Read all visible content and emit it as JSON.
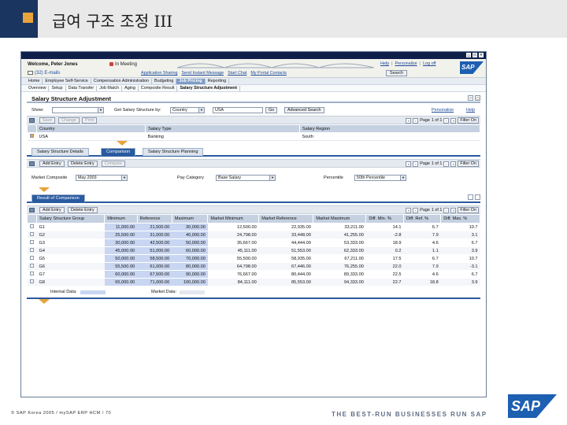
{
  "slide": {
    "title": "급여 구조 조정 III",
    "copyright": "© SAP Korea 2005 / mySAP ERP HCM / 70",
    "slogan": "THE BEST-RUN BUSINESSES RUN SAP",
    "logo": "SAP"
  },
  "portal": {
    "welcome": "Welcome, Peter Jones",
    "status": "In Meeting",
    "emails": "(32) E-mails",
    "top_links": [
      "Help",
      "Personalize",
      "Log off"
    ],
    "links": [
      "Application Sharing",
      "Send Instant Message",
      "Start Chat",
      "My Portal Contacts"
    ],
    "search_button": "Search",
    "nav_top": [
      "Home",
      "Employee Self-Service",
      "Compensation Administration",
      "Budgeting",
      "Job Pricing",
      "Reporting"
    ],
    "nav_top_active": 4,
    "nav_sub": [
      "Overview",
      "Setup",
      "Data Transfer",
      "Job Match",
      "Aging",
      "Composite Result",
      "Salary Structure Adjustment"
    ]
  },
  "page": {
    "title": "Salary Structure Adjustment",
    "show_label": "Show:",
    "get_label": "Get Salary Structure by:",
    "get_value": "Country",
    "country_value": "USA",
    "go": "Go",
    "advanced": "Advanced Search",
    "personalize": "Personalize",
    "help": "Help",
    "toolbar_buttons": [
      "Save",
      "Change",
      "Print"
    ],
    "page_text": "Page",
    "page_of": "1 of 1",
    "filter": "Filter On",
    "columns": [
      "Country",
      "Salary Type",
      "Salary Region"
    ],
    "row": [
      "USA",
      "Banking",
      "South"
    ]
  },
  "tabs": [
    "Salary Structure Details",
    "Comparison",
    "Salary Structure Planning"
  ],
  "comparison": {
    "add_entry": "Add Entry",
    "delete_entry": "Delete Entry",
    "compare": "Compare",
    "market_composite_label": "Market Composite",
    "market_composite_value": "May 2003",
    "pay_category_label": "Pay Category",
    "pay_category_value": "Base Salary",
    "percentile_label": "Percentile",
    "percentile_value": "50th Percentile"
  },
  "result": {
    "tab": "Result of Comparison",
    "columns": [
      "Salary Structure Group",
      "Minimum",
      "Reference",
      "Maximum",
      "Market Minimum",
      "Market Reference",
      "Market Maximum",
      "Diff. Min. %",
      "Diff. Ref. %",
      "Diff. Max. %"
    ],
    "rows": [
      [
        "G1",
        "11,000.00",
        "21,500.00",
        "30,000.00",
        "12,500.00",
        "22,935.00",
        "33,211.00",
        "14.1",
        "6.7",
        "10.7"
      ],
      [
        "G2",
        "25,500.00",
        "31,000.00",
        "40,000.00",
        "24,798.00",
        "33,448.00",
        "41,255.00",
        "-2.8",
        "7.9",
        "3.1"
      ],
      [
        "G3",
        "30,000.00",
        "42,500.00",
        "50,000.00",
        "35,667.00",
        "44,444.00",
        "53,333.00",
        "18.9",
        "4.6",
        "6.7"
      ],
      [
        "G4",
        "45,000.00",
        "51,000.00",
        "60,000.00",
        "45,111.00",
        "51,553.00",
        "62,333.00",
        "0.2",
        "1.1",
        "3.9"
      ],
      [
        "G5",
        "50,000.00",
        "58,500.00",
        "70,000.00",
        "55,500.00",
        "58,935.00",
        "67,211.00",
        "17.5",
        "6.7",
        "10.7"
      ],
      [
        "G6",
        "55,500.00",
        "61,000.00",
        "80,000.00",
        "64,798.00",
        "67,446.00",
        "76,255.00",
        "22.0",
        "7.9",
        "-3.1"
      ],
      [
        "G7",
        "60,000.00",
        "67,500.00",
        "90,000.00",
        "76,667.00",
        "80,444.00",
        "89,333.00",
        "22.5",
        "4.6",
        "6.7"
      ],
      [
        "G8",
        "65,000.00",
        "71,000.00",
        "100,000.00",
        "84,111.00",
        "85,553.00",
        "94,333.00",
        "22.7",
        "18.8",
        "3.9"
      ]
    ],
    "legend_internal": "Internal Data:",
    "legend_market": "Market Data:"
  },
  "colors": {
    "header_navy": "#1a3560",
    "accent_orange": "#e8a33c",
    "internal_data": "#c9d6f2",
    "market_data": "#e3e6f0"
  }
}
